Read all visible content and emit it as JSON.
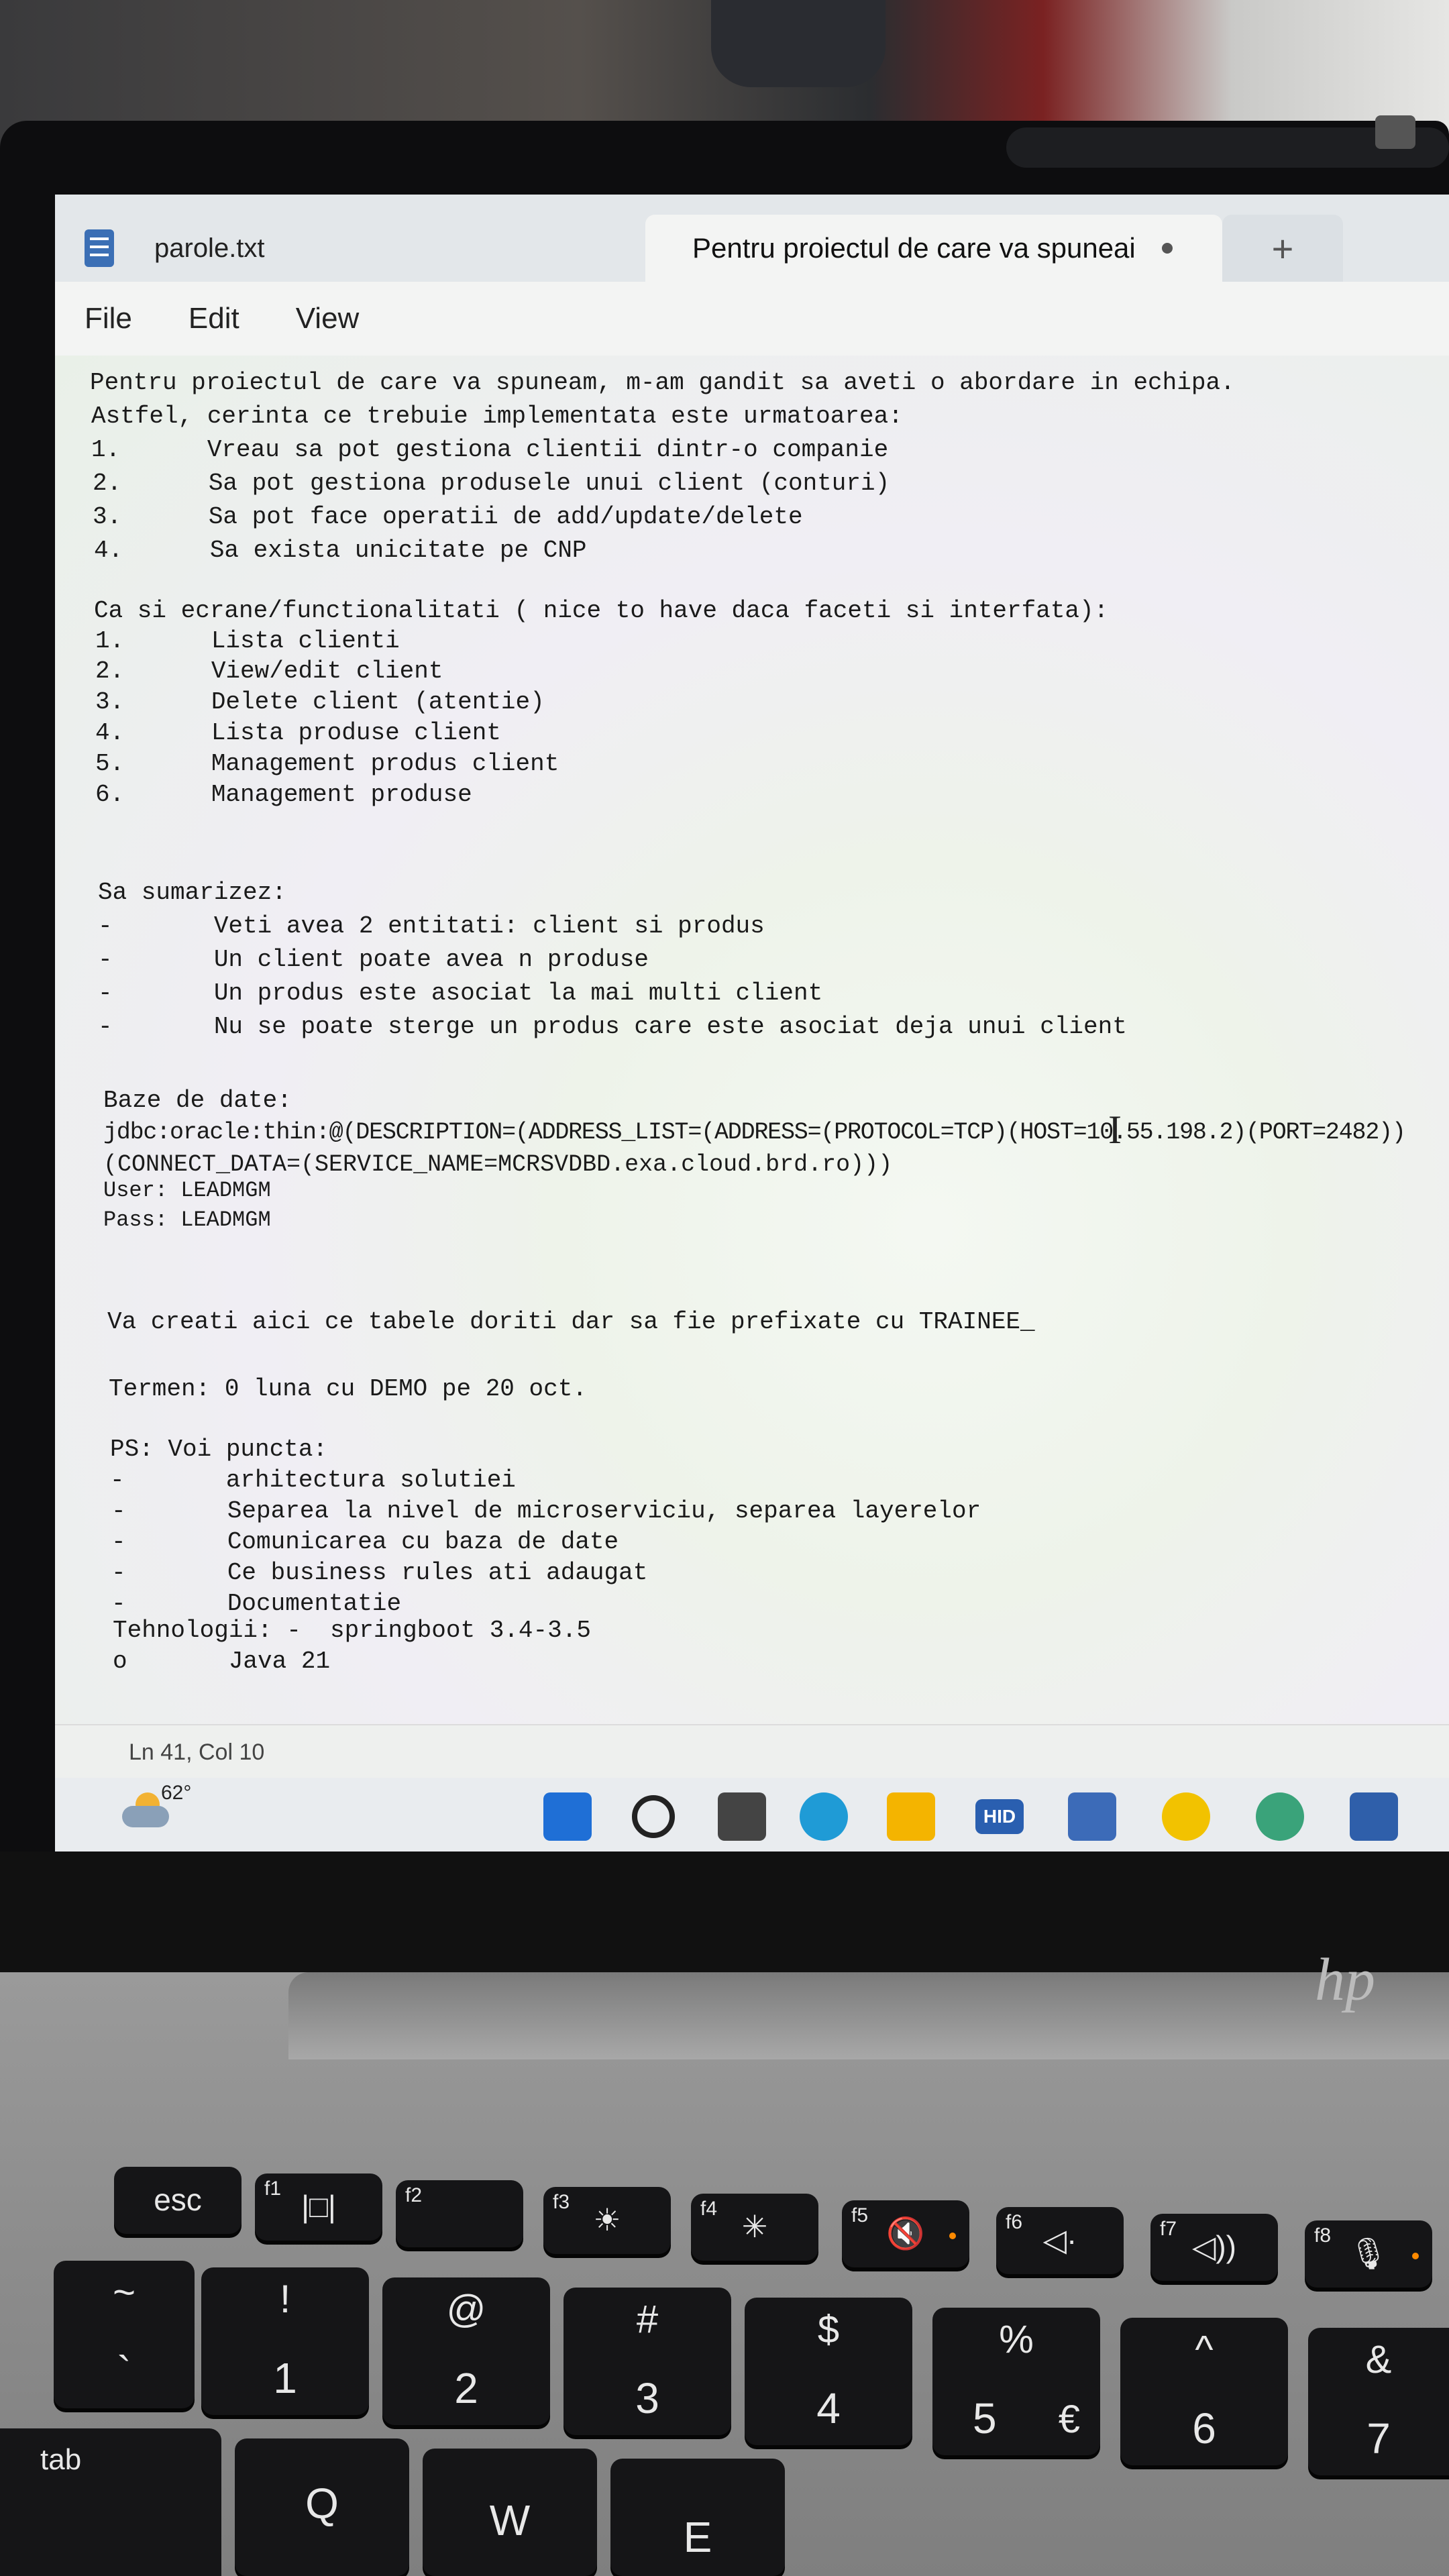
{
  "window": {
    "tabs": [
      {
        "label": "parole.txt",
        "active": false
      },
      {
        "label": "Pentru proiectul de care va spuneai",
        "active": true,
        "unsaved": true
      }
    ],
    "new_tab_glyph": "+",
    "menu": [
      "File",
      "Edit",
      "View"
    ]
  },
  "editor": {
    "lines": [
      "Pentru proiectul de care va spuneam, m-am gandit sa aveti o abordare in echipa.",
      "Astfel, cerinta ce trebuie implementata este urmatoarea:",
      "1.      Vreau sa pot gestiona clientii dintr-o companie",
      "2.      Sa pot gestiona produsele unui client (conturi)",
      "3.      Sa pot face operatii de add/update/delete",
      "4.      Sa exista unicitate pe CNP",
      "Ca si ecrane/functionalitati ( nice to have daca faceti si interfata):",
      "1.      Lista clienti",
      "2.      View/edit client",
      "3.      Delete client (atentie)",
      "4.      Lista produse client",
      "5.      Management produs client",
      "6.      Management produse",
      "Sa sumarizez:",
      "-       Veti avea 2 entitati: client si produs",
      "-       Un client poate avea n produse",
      "-       Un produs este asociat la mai multi client",
      "-       Nu se poate sterge un produs care este asociat deja unui client",
      "Baze de date:",
      "jdbc:oracle:thin:@(DESCRIPTION=(ADDRESS_LIST=(ADDRESS=(PROTOCOL=TCP)(HOST=10.55.198.2)(PORT=2482))",
      "(CONNECT_DATA=(SERVICE_NAME=MCRSVDBD.exa.cloud.brd.ro)))",
      "User: LEADMGM",
      "Pass: LEADMGM",
      "Va creati aici ce tabele doriti dar sa fie prefixate cu TRAINEE_",
      "Termen: 0 luna cu DEMO pe 20 oct.",
      "PS: Voi puncta:",
      "-       arhitectura solutiei",
      "-       Separea la nivel de microserviciu, separea layerelor",
      "-       Comunicarea cu baza de date",
      "-       Ce business rules ati adaugat",
      "-       Documentatie",
      "Tehnologii: -  springboot 3.4-3.5",
      "o       Java 21"
    ]
  },
  "status": {
    "position": "Ln 41, Col 10"
  },
  "taskbar": {
    "weather_temp": "62°",
    "icons": [
      "windows-start-icon",
      "search-icon",
      "task-view-icon",
      "edge-browser-icon",
      "file-explorer-icon",
      "hid-app-icon",
      "vpn-lock-icon",
      "norton-check-icon",
      "globe-app-icon",
      "lock-app-icon"
    ],
    "hid_label": "HID"
  },
  "laptop": {
    "brand": "hp"
  },
  "keyboard": {
    "fn_row": [
      {
        "main": "esc"
      },
      {
        "fn": "f1",
        "main": "|□|"
      },
      {
        "fn": "f2",
        "main": ""
      },
      {
        "fn": "f3",
        "main": "☀"
      },
      {
        "fn": "f4",
        "main": "✳"
      },
      {
        "fn": "f5",
        "main": "🔇"
      },
      {
        "fn": "f6",
        "main": "◁·"
      },
      {
        "fn": "f7",
        "main": "◁))"
      },
      {
        "fn": "f8",
        "main": "🎙"
      }
    ],
    "num_row": [
      {
        "top": "~",
        "bot": "`"
      },
      {
        "top": "!",
        "bot": "1"
      },
      {
        "top": "@",
        "bot": "2"
      },
      {
        "top": "#",
        "bot": "3"
      },
      {
        "top": "$",
        "bot": "4"
      },
      {
        "top": "%",
        "bot": "5",
        "extra": "€"
      },
      {
        "top": "^",
        "bot": "6"
      },
      {
        "top": "&",
        "bot": "7"
      }
    ],
    "letter_row": [
      {
        "main": "tab"
      },
      {
        "main": "Q"
      },
      {
        "main": "W"
      },
      {
        "main": "E"
      }
    ]
  }
}
